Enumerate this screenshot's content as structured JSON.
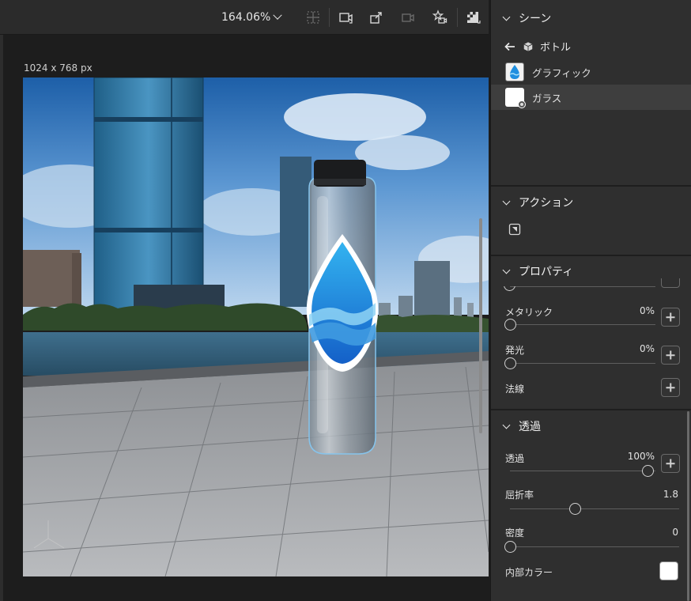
{
  "toolbar": {
    "zoom_label": "164.06%",
    "icons": [
      "grid-snap-icon",
      "frame-select-icon",
      "share-export-icon",
      "camera-view-icon",
      "add-starred-camera-icon",
      "render-preview-icon"
    ]
  },
  "canvas": {
    "dimension_label": "1024 x 768 px"
  },
  "scene_panel": {
    "title": "シーン",
    "breadcrumb_label": "ボトル",
    "layers": [
      {
        "label": "グラフィック",
        "selected": false
      },
      {
        "label": "ガラス",
        "selected": true
      }
    ]
  },
  "actions_panel": {
    "title": "アクション"
  },
  "properties_panel": {
    "title": "プロパティ",
    "metallic": {
      "label": "メタリック",
      "value": "0%",
      "level": 0
    },
    "emission": {
      "label": "発光",
      "value": "0%",
      "level": 0
    },
    "normal": {
      "label": "法線"
    }
  },
  "transmission_panel": {
    "title": "透過",
    "transmission": {
      "label": "透過",
      "value": "100%",
      "level": 1.0
    },
    "ior": {
      "label": "屈折率",
      "value": "1.8",
      "level": 0.47
    },
    "density": {
      "label": "密度",
      "value": "0",
      "level": 0
    },
    "interior_color": {
      "label": "内部カラー",
      "color": "#ffffff"
    }
  },
  "colors": {
    "panel_bg": "#2f2f2f",
    "accent_blue": "#1f8fe0",
    "selected_row": "#3e3e3e"
  }
}
